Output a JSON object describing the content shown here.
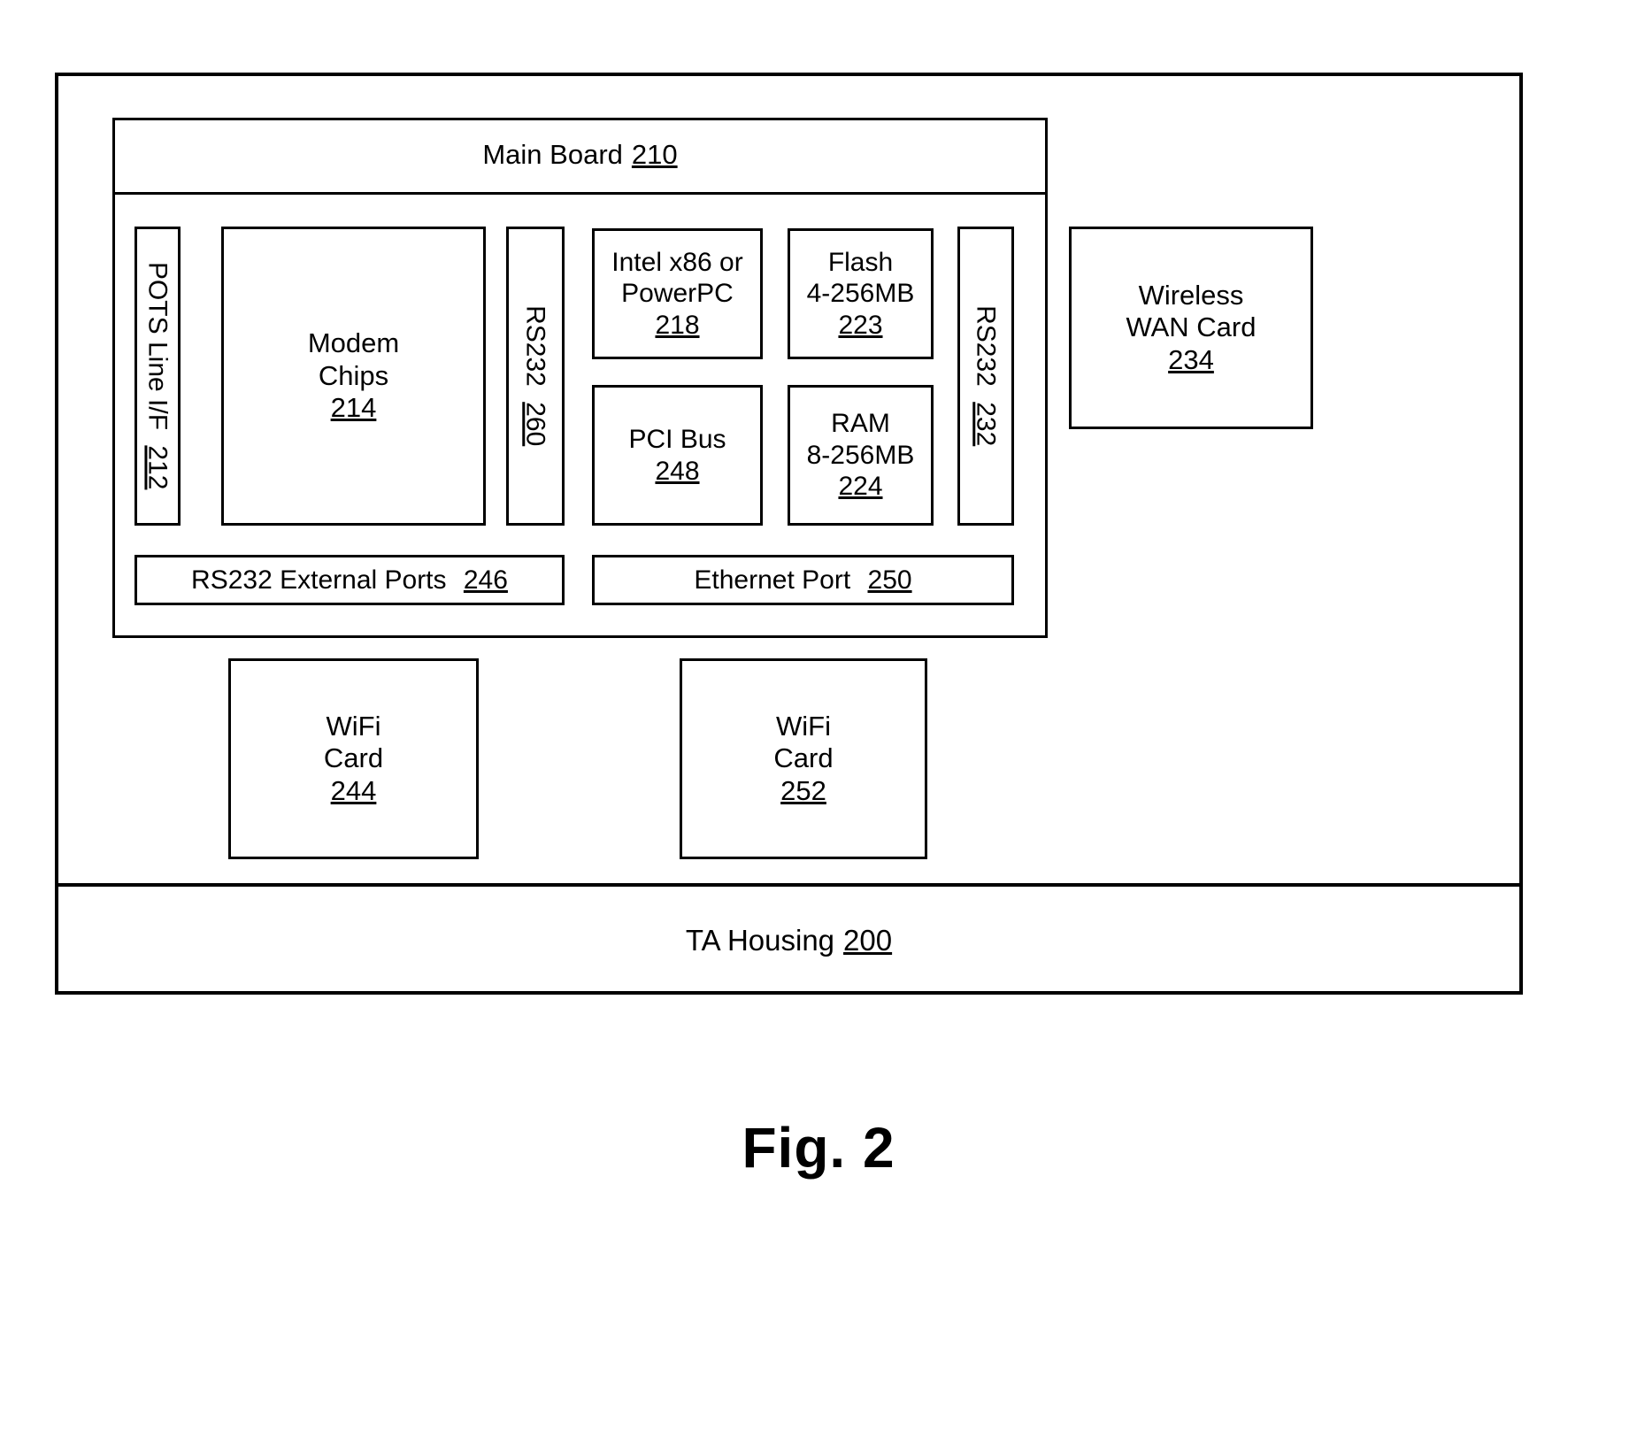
{
  "figure": {
    "caption": "Fig. 2"
  },
  "housing": {
    "label": "TA Housing",
    "number": "200"
  },
  "main_board": {
    "label": "Main Board",
    "number": "210"
  },
  "components": {
    "pots": {
      "label": "POTS Line I/F",
      "number": "212"
    },
    "modem": {
      "line1": "Modem",
      "line2": "Chips",
      "number": "214"
    },
    "rs232_260": {
      "label": "RS232",
      "number": "260"
    },
    "cpu": {
      "line1": "Intel x86 or",
      "line2": "PowerPC",
      "number": "218"
    },
    "flash": {
      "line1": "Flash",
      "line2": "4-256MB",
      "number": "223"
    },
    "pci_bus": {
      "line1": "PCI Bus",
      "number": "248"
    },
    "ram": {
      "line1": "RAM",
      "line2": "8-256MB",
      "number": "224"
    },
    "rs232_232": {
      "label": "RS232",
      "number": "232"
    },
    "rs232_external": {
      "label": "RS232 External Ports",
      "number": "246"
    },
    "ethernet": {
      "label": "Ethernet Port",
      "number": "250"
    },
    "wireless_wan": {
      "line1": "Wireless",
      "line2": "WAN Card",
      "number": "234"
    },
    "wifi_244": {
      "line1": "WiFi",
      "line2": "Card",
      "number": "244"
    },
    "wifi_252": {
      "line1": "WiFi",
      "line2": "Card",
      "number": "252"
    }
  },
  "colors": {
    "stroke": "#000000",
    "background": "#ffffff"
  }
}
